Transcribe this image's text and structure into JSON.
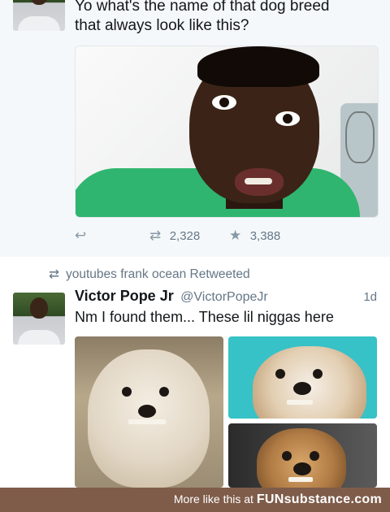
{
  "tweet1": {
    "text_line1": "Yo what's the name of that dog breed",
    "text_line2": "that always look like this?",
    "retweet_count": "2,328",
    "like_count": "3,388",
    "icons": {
      "reply": "reply-icon",
      "retweet": "retweet-icon",
      "like": "star-icon"
    }
  },
  "tweet2": {
    "retweeted_by": "youtubes frank ocean Retweeted",
    "display_name": "Victor Pope Jr",
    "handle": "@VictorPopeJr",
    "time": "1d",
    "text": "Nm I found them... These lil  niggas here"
  },
  "footer": {
    "prefix": "More like this at ",
    "brand": "FUNsubstance.com"
  },
  "colors": {
    "footer_bg": "#7f5c4a",
    "muted_text": "#657786",
    "icon_gray": "#8899a6"
  }
}
